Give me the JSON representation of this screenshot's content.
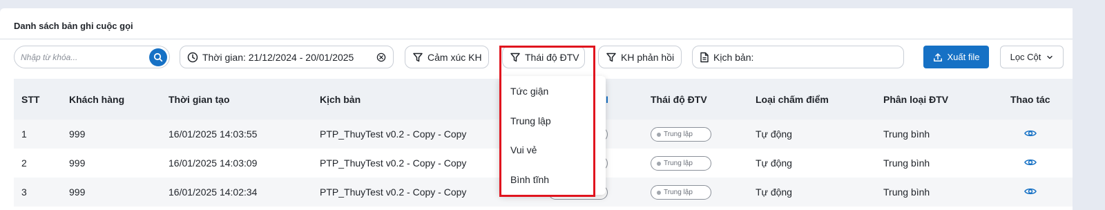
{
  "page": {
    "title": "Danh sách bản ghi cuộc gọi"
  },
  "toolbar": {
    "search_placeholder": "Nhập từ khóa...",
    "time_filter": "Thời gian: 21/12/2024 - 20/01/2025",
    "emotion_filter": "Cảm xúc KH",
    "attitude_filter": "Thái độ ĐTV",
    "feedback_filter": "KH phản hồi",
    "script_filter": "Kịch bản:",
    "export_label": "Xuất file",
    "columns_label": "Lọc Cột"
  },
  "table": {
    "headers": {
      "stt": "STT",
      "customer": "Khách hàng",
      "created": "Thời gian tạo",
      "script": "Kịch bản",
      "emotion_partial": "I",
      "attitude": "Thái độ ĐTV",
      "scoring": "Loại chấm điểm",
      "classification": "Phân loại ĐTV",
      "actions": "Thao tác"
    },
    "rows": [
      {
        "stt": "1",
        "customer": "999",
        "created": "16/01/2025 14:03:55",
        "script": "PTP_ThuyTest v0.2 - Copy - Copy",
        "attitude": "Trung lập",
        "scoring": "Tự động",
        "classification": "Trung bình"
      },
      {
        "stt": "2",
        "customer": "999",
        "created": "16/01/2025 14:03:09",
        "script": "PTP_ThuyTest v0.2 - Copy - Copy",
        "attitude": "Trung lập",
        "scoring": "Tự động",
        "classification": "Trung bình"
      },
      {
        "stt": "3",
        "customer": "999",
        "created": "16/01/2025 14:02:34",
        "script": "PTP_ThuyTest v0.2 - Copy - Copy",
        "attitude": "Trung lập",
        "scoring": "Tự động",
        "classification": "Trung bình"
      }
    ]
  },
  "dropdown": {
    "options": [
      "Tức giận",
      "Trung lập",
      "Vui vẻ",
      "Bình tĩnh"
    ]
  },
  "colors": {
    "primary": "#1671c5",
    "highlight": "#e0141e",
    "header_bg": "#eef1f5"
  },
  "icons": [
    "search-icon",
    "clock-icon",
    "clear-icon",
    "filter-icon",
    "document-icon",
    "upload-icon",
    "chevron-down-icon",
    "eye-icon"
  ]
}
